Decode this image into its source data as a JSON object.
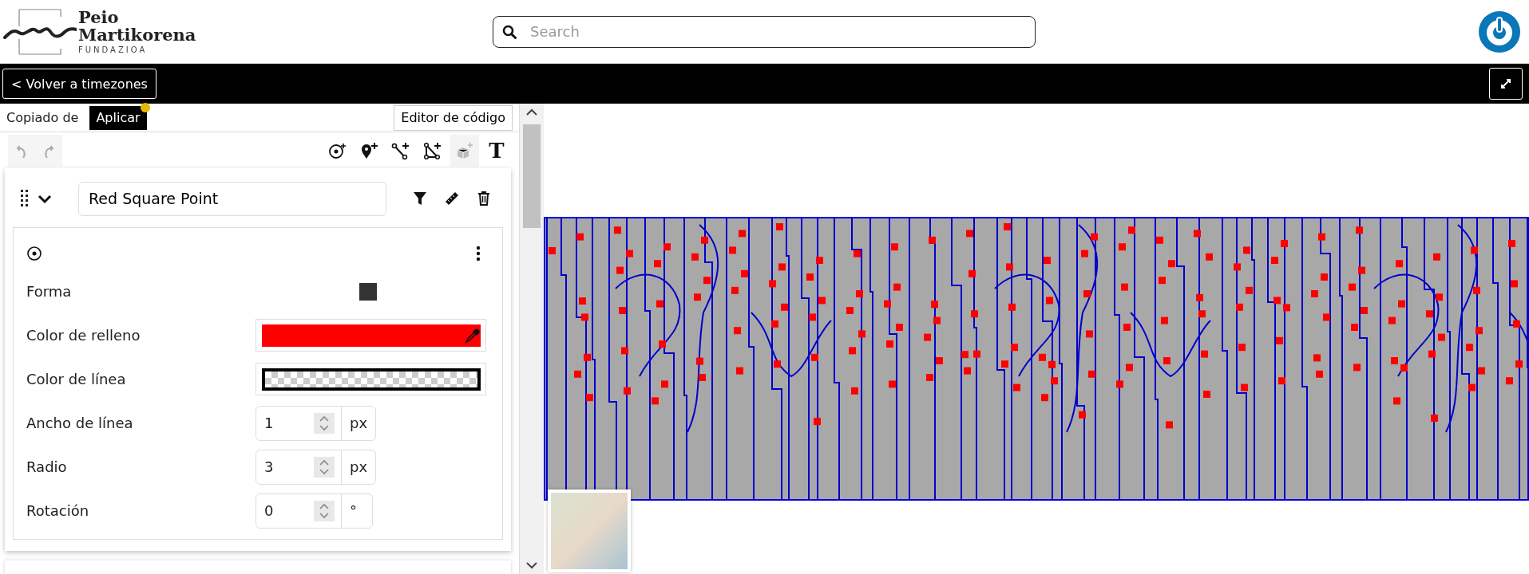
{
  "header": {
    "logo": {
      "line1": "Peio",
      "line2": "Martikorena",
      "tagline": "FUNDAZIOA"
    },
    "search": {
      "placeholder": "Search"
    }
  },
  "nav_bar": {
    "back_button": "< Volver a timezones"
  },
  "panel": {
    "copied_from": "Copiado de",
    "apply_button": {
      "label": "Aplicar",
      "notification": true
    },
    "code_editor_button": "Editor de código",
    "history": [
      {
        "kind": "undo",
        "disabled": true
      },
      {
        "kind": "redo",
        "disabled": true
      }
    ],
    "tools": [
      {
        "kind": "point",
        "disabled": false
      },
      {
        "kind": "marker",
        "disabled": false
      },
      {
        "kind": "line",
        "disabled": false
      },
      {
        "kind": "polygon",
        "disabled": false
      },
      {
        "kind": "extrusion",
        "disabled": true
      },
      {
        "kind": "text",
        "label": "T",
        "disabled": false
      }
    ],
    "layer": {
      "name": "Red Square Point",
      "expanded": true,
      "style": {
        "rows": [
          {
            "kind": "shape",
            "label": "Forma"
          },
          {
            "kind": "color",
            "label": "Color de relleno",
            "color": "#ff0000",
            "transparent": false
          },
          {
            "kind": "color",
            "label": "Color de línea",
            "color": "#000000",
            "transparent": true
          },
          {
            "kind": "number",
            "label": "Ancho de línea",
            "value": "1",
            "unit": "px"
          },
          {
            "kind": "number",
            "label": "Radio",
            "value": "3",
            "unit": "px"
          },
          {
            "kind": "number",
            "label": "Rotación",
            "value": "0",
            "unit": "°"
          }
        ]
      }
    }
  }
}
